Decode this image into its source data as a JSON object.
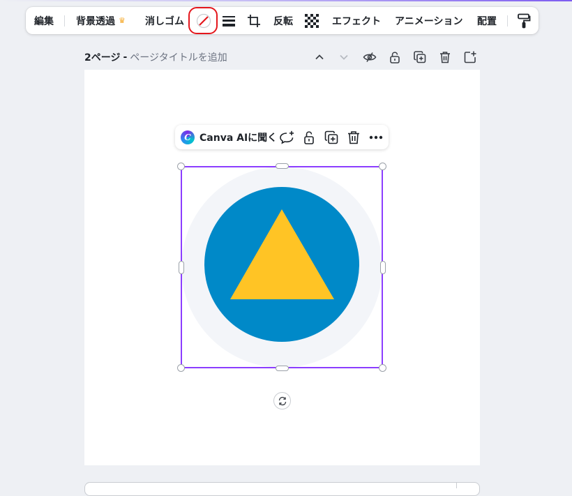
{
  "toolbar": {
    "edit_label": "編集",
    "bg_remove_label": "背景透過",
    "eraser_label": "消しゴム",
    "flip_label": "反転",
    "effects_label": "エフェクト",
    "animation_label": "アニメーション",
    "position_label": "配置",
    "icons": [
      "crown-icon",
      "no-color-icon",
      "border-style-icon",
      "crop-icon",
      "transparency-icon",
      "paint-format-icon"
    ]
  },
  "page_header": {
    "page_number": "2ページ",
    "separator": "-",
    "title_placeholder": "ページタイトルを追加",
    "icons": [
      "chevron-up-icon",
      "chevron-down-icon",
      "hide-icon",
      "lock-icon",
      "duplicate-icon",
      "trash-icon",
      "add-page-icon"
    ]
  },
  "context_menu": {
    "ai_logo": "C",
    "ai_label": "Canva AIに聞く",
    "icons": [
      "comment-icon",
      "lock-icon",
      "duplicate-icon",
      "trash-icon",
      "more-icon"
    ]
  },
  "graphic": {
    "outer_circle_color": "#f3f5f9",
    "circle_color": "#0089c8",
    "triangle_color": "#ffc425",
    "selection_color": "#8b3dff"
  },
  "colors": {
    "highlight_ring": "#e4161c",
    "canvas_bg": "#eef0f4"
  }
}
